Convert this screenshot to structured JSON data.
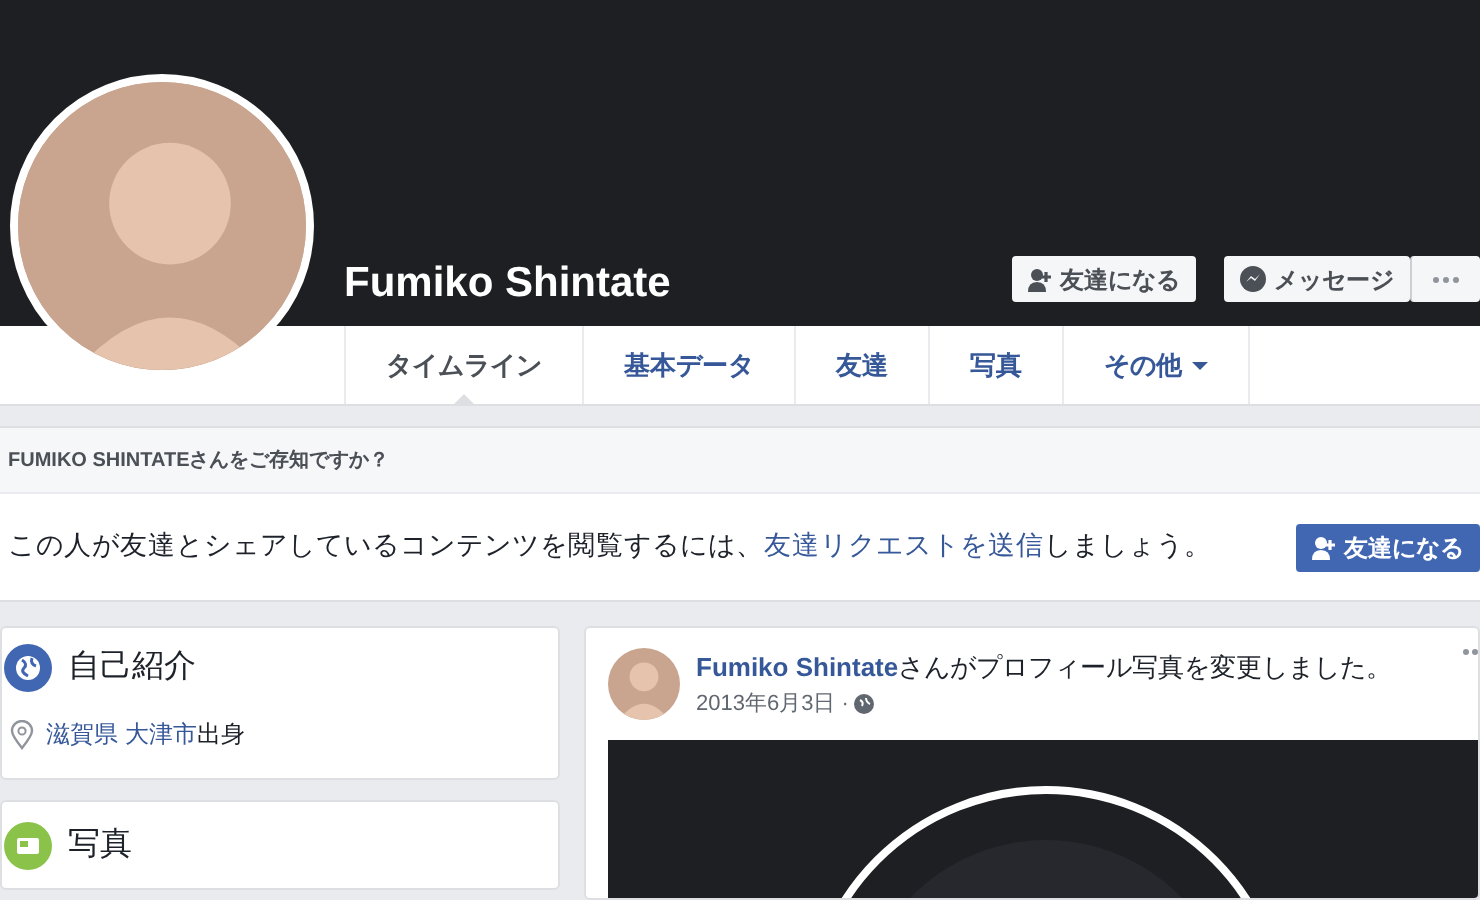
{
  "profile": {
    "name": "Fumiko Shintate"
  },
  "header_buttons": [
    {
      "kind": "add-friend",
      "label": "友達になる"
    },
    {
      "kind": "message",
      "label": "メッセージ"
    },
    {
      "kind": "more"
    }
  ],
  "tabs": [
    {
      "label": "タイムライン",
      "selected": true
    },
    {
      "label": "基本データ",
      "selected": false
    },
    {
      "label": "友達",
      "selected": false
    },
    {
      "label": "写真",
      "selected": false
    },
    {
      "label": "その他",
      "selected": false,
      "dropdown": true
    }
  ],
  "friend_prompt": {
    "title": "FUMIKO SHINTATEさんをご存知ですか？",
    "before": "この人が友達とシェアしているコンテンツを閲覧するには、",
    "link": "友達リクエストを送信",
    "after": "しましょう。",
    "button": "友達になる"
  },
  "intro": {
    "title": "自己紹介",
    "place_link": "滋賀県 大津市",
    "place_suffix": "出身"
  },
  "photos": {
    "title": "写真"
  },
  "post": {
    "author": "Fumiko Shintate",
    "action": "さんがプロフィール写真を変更しました。",
    "date": "2013年6月3日",
    "separator": "·"
  }
}
